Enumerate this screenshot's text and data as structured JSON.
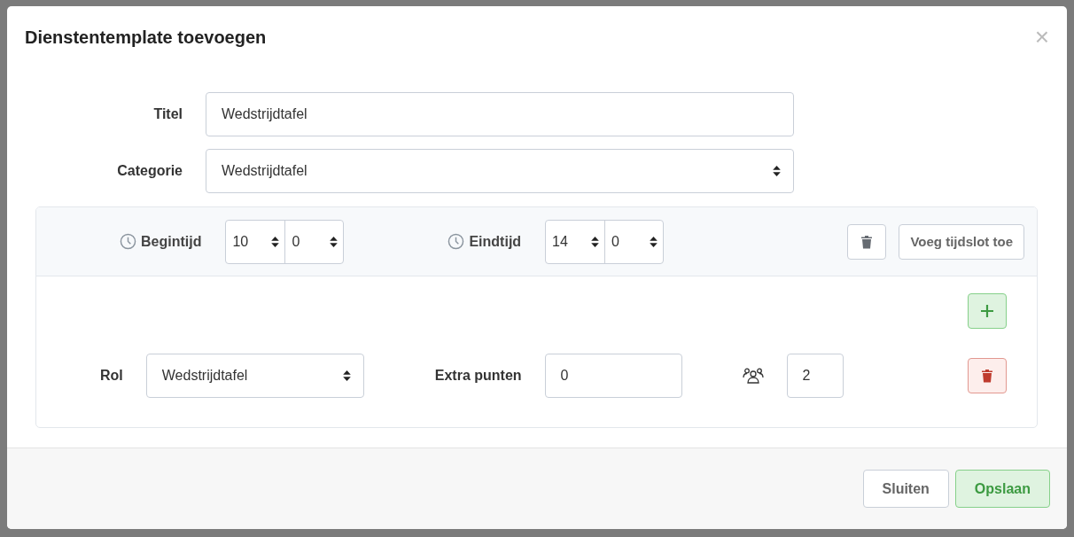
{
  "dialog": {
    "title": "Dienstentemplate toevoegen",
    "close": "×"
  },
  "fields": [
    {
      "label": "Titel",
      "kind": "text",
      "value": "Wedstrijdtafel"
    },
    {
      "label": "Categorie",
      "kind": "select",
      "value": "Wedstrijdtafel"
    }
  ],
  "timeslot": {
    "start": {
      "label": "Begintijd",
      "hour": "10",
      "minute": "0"
    },
    "end": {
      "label": "Eindtijd",
      "hour": "14",
      "minute": "0"
    },
    "add_timeslot_button": "Voeg tijdslot toe",
    "roles": [
      {
        "label": "Rol",
        "role": "Wedstrijdtafel",
        "extra_points_label": "Extra punten",
        "extra_points": "0",
        "count": "2"
      }
    ]
  },
  "footer_buttons": [
    {
      "label": "Sluiten",
      "kind": "default"
    },
    {
      "label": "Opslaan",
      "kind": "success"
    }
  ]
}
